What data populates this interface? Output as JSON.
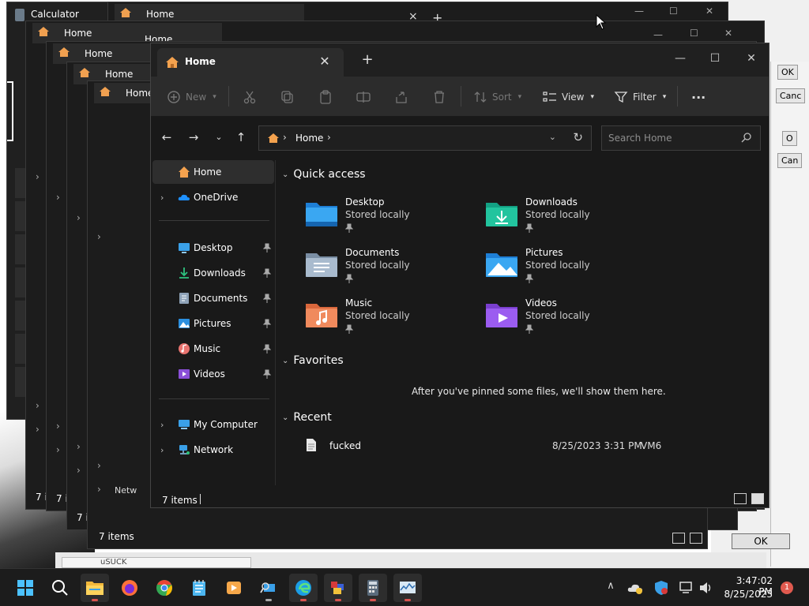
{
  "explorer": {
    "tab_title": "Home",
    "toolbar": {
      "new_label": "New",
      "sort_label": "Sort",
      "view_label": "View",
      "filter_label": "Filter",
      "more_label": "···"
    },
    "address": {
      "path": "Home"
    },
    "search_placeholder": "Search Home",
    "sidebar": [
      {
        "label": "Home",
        "selected": true
      },
      {
        "label": "OneDrive"
      },
      {
        "label": "Desktop",
        "pinned": true
      },
      {
        "label": "Downloads",
        "pinned": true
      },
      {
        "label": "Documents",
        "pinned": true
      },
      {
        "label": "Pictures",
        "pinned": true
      },
      {
        "label": "Music",
        "pinned": true
      },
      {
        "label": "Videos",
        "pinned": true
      },
      {
        "label": "My Computer"
      },
      {
        "label": "Network"
      }
    ],
    "sections": {
      "quick_access": "Quick access",
      "favorites": "Favorites",
      "recent": "Recent"
    },
    "quick_access": [
      {
        "name": "Desktop",
        "sub": "Stored locally"
      },
      {
        "name": "Downloads",
        "sub": "Stored locally"
      },
      {
        "name": "Documents",
        "sub": "Stored locally"
      },
      {
        "name": "Pictures",
        "sub": "Stored locally"
      },
      {
        "name": "Music",
        "sub": "Stored locally"
      },
      {
        "name": "Videos",
        "sub": "Stored locally"
      }
    ],
    "favorites_message": "After you've pinned some files, we'll show them here.",
    "recent": [
      {
        "name": "fucked",
        "date": "8/25/2023 3:31 PM",
        "location": "VM6"
      }
    ],
    "status": "7 items"
  },
  "background": {
    "calculator_title": "Calculator",
    "ghost_tab_title": "Home",
    "ghost_status": "7 items",
    "ghost_status_short": "7 i",
    "ghost_network": "Netw",
    "dialog_buttons": [
      "OK",
      "Canc",
      "O",
      "Can"
    ],
    "ok_button": "OK",
    "bottom_strip": "uSUCK"
  },
  "taskbar": {
    "time": "3:47:02 PM",
    "date": "8/25/2023",
    "notification_count": "1"
  },
  "colors": {
    "accent": "#4cc2ff",
    "window_bg": "#191919",
    "toolbar_bg": "#2c2c2c",
    "taskbar_bg": "#1c1c1c"
  }
}
